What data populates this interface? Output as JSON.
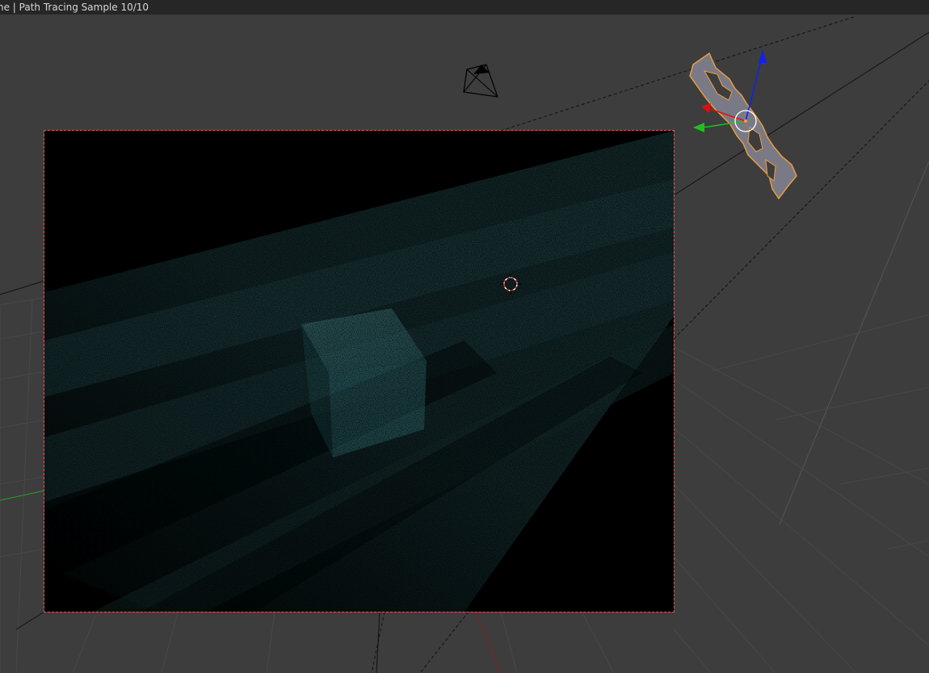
{
  "status_bar": {
    "text": "ne | Path Tracing Sample 10/10"
  },
  "render_preview": {
    "samples_current": 10,
    "samples_total": 10
  },
  "colors": {
    "viewport_bg": "#3d3d3d",
    "grid_line": "#4a4a4a",
    "render_border": "#ff4a4a",
    "volumetric_teal": "#2f6b70",
    "selection_outline": "#f0a040",
    "axis_x": "#e01010",
    "axis_y": "#20c020",
    "axis_z": "#1020f0"
  },
  "icons": {
    "camera": "camera-icon",
    "light": "spot-light-icon",
    "cursor": "3d-cursor-icon",
    "gizmo": "transform-gizmo-icon"
  }
}
